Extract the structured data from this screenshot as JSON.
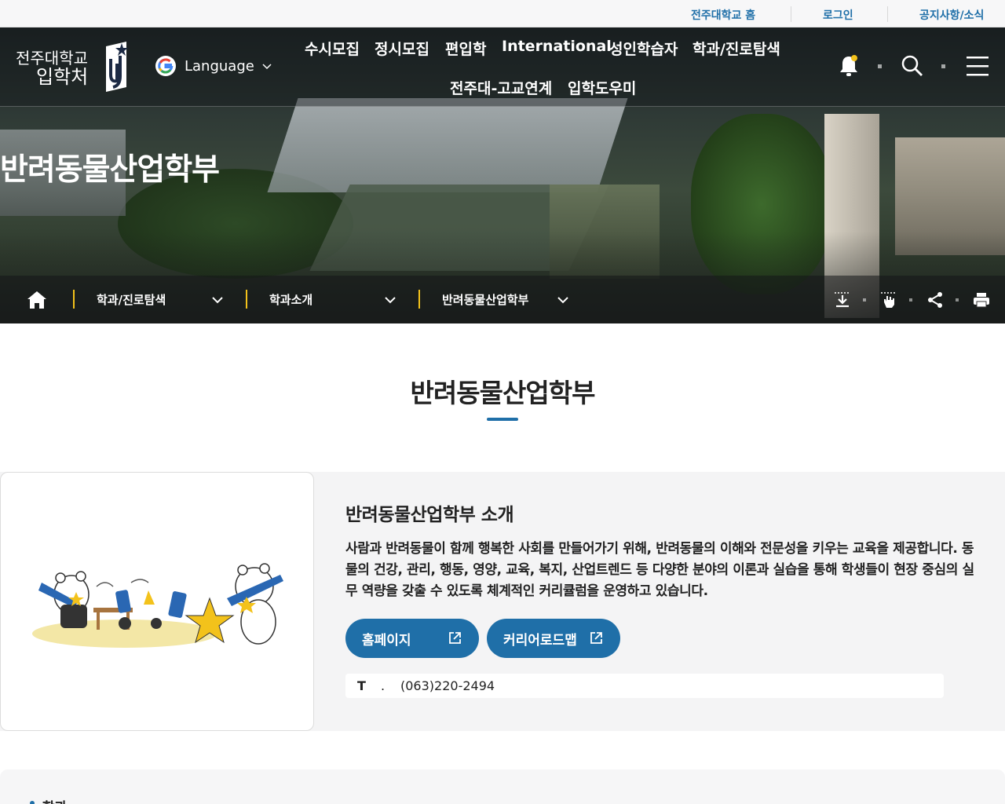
{
  "topbar": {
    "links": [
      "전주대학교 홈",
      "로그인",
      "공지사항/소식"
    ]
  },
  "header": {
    "logo_line1": "전주대학교",
    "logo_line2": "입학처",
    "language_label": "Language",
    "nav_row1": [
      "수시모집",
      "정시모집",
      "편입학",
      "International",
      "성인학습자",
      "학과/진로탐색"
    ],
    "nav_row2": [
      "전주대-고교연계",
      "입학도우미"
    ],
    "icons": [
      "bell-icon",
      "search-icon",
      "menu-icon"
    ]
  },
  "hero": {
    "title": "반려동물산업학부"
  },
  "breadcrumb": {
    "items": [
      "학과/진로탐색",
      "학과소개",
      "반려동물산업학부"
    ],
    "tools": [
      "download-icon",
      "touch-icon",
      "share-icon",
      "print-icon"
    ]
  },
  "main": {
    "heading": "반려동물산업학부",
    "intro_title": "반려동물산업학부 소개",
    "intro_desc": "사람과 반려동물이 함께 행복한 사회를 만들어가기 위해, 반려동물의 이해와 전문성을 키우는 교육을 제공합니다. 동물의 건강, 관리, 행동, 영양, 교육, 복지, 산업트렌드 등 다양한 분야의 이론과 실습을 통해 학생들이 현장 중심의 실무 역량을 갖출 수 있도록 체계적인 커리큘럼을 운영하고 있습니다.",
    "homepage_button": "홈페이지",
    "roadmap_button": "커리어로드맵",
    "phone_label": "T",
    "phone_dot": ".",
    "phone_value": "(063)220-2494",
    "section_label": "학과"
  },
  "colors": {
    "accent": "#1f6fa8",
    "highlight": "#f3c21b"
  }
}
